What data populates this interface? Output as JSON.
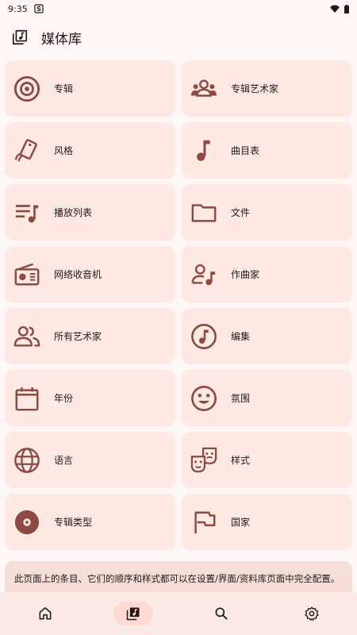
{
  "status_bar": {
    "time": "9:35"
  },
  "app_bar": {
    "title": "媒体库",
    "icon": "library-icon"
  },
  "tiles": [
    {
      "label": "专辑",
      "icon": "album-icon"
    },
    {
      "label": "专辑艺术家",
      "icon": "album-artist-icon"
    },
    {
      "label": "风格",
      "icon": "genre-icon"
    },
    {
      "label": "曲目表",
      "icon": "music-note-icon"
    },
    {
      "label": "播放列表",
      "icon": "playlist-icon"
    },
    {
      "label": "文件",
      "icon": "folder-icon"
    },
    {
      "label": "网络收音机",
      "icon": "radio-icon"
    },
    {
      "label": "作曲家",
      "icon": "composer-icon"
    },
    {
      "label": "所有艺术家",
      "icon": "artists-icon"
    },
    {
      "label": "编集",
      "icon": "compilation-icon"
    },
    {
      "label": "年份",
      "icon": "calendar-icon"
    },
    {
      "label": "氛围",
      "icon": "mood-icon"
    },
    {
      "label": "语言",
      "icon": "globe-icon"
    },
    {
      "label": "样式",
      "icon": "style-masks-icon"
    },
    {
      "label": "专辑类型",
      "icon": "album-type-icon"
    },
    {
      "label": "国家",
      "icon": "flag-icon"
    }
  ],
  "notice": {
    "text": "此页面上的条目、它们的顺序和样式都可以在设置/界面/资料库页面中完全配置。"
  },
  "nav": [
    {
      "label": "home",
      "icon": "home-icon"
    },
    {
      "label": "library",
      "icon": "library-icon",
      "active": true
    },
    {
      "label": "search",
      "icon": "search-icon"
    },
    {
      "label": "settings",
      "icon": "settings-icon"
    }
  ],
  "colors": {
    "accent": "#8c4a40",
    "tile_bg": "#ffe9e5",
    "page_bg": "#fff7f5"
  }
}
